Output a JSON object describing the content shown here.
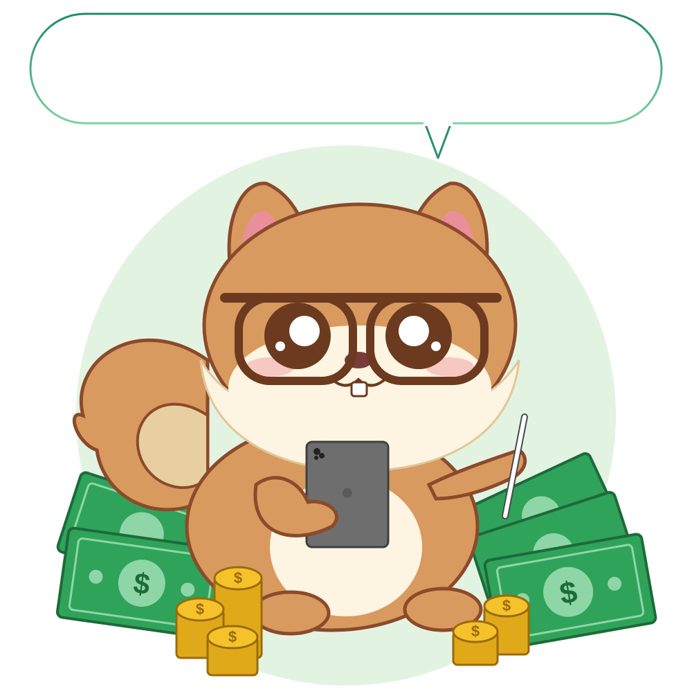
{
  "speech_bubble": {
    "text": ""
  },
  "colors": {
    "bubble_border_top": "#1f8a6f",
    "bubble_border_bottom": "#7ed3a0",
    "circle_bg": "#e3f3e2",
    "fur": "#d99a5f",
    "fur_outline": "#8b4a2b",
    "belly": "#fdf5e1",
    "glasses": "#6b3a1f",
    "tablet": "#6e6e6e",
    "money_green": "#2fa35a",
    "coin_gold": "#f5c22b"
  },
  "icons": [
    "dollar-bill-icon",
    "gold-coin-icon",
    "tablet-icon",
    "stylus-icon",
    "squirrel-mascot"
  ]
}
